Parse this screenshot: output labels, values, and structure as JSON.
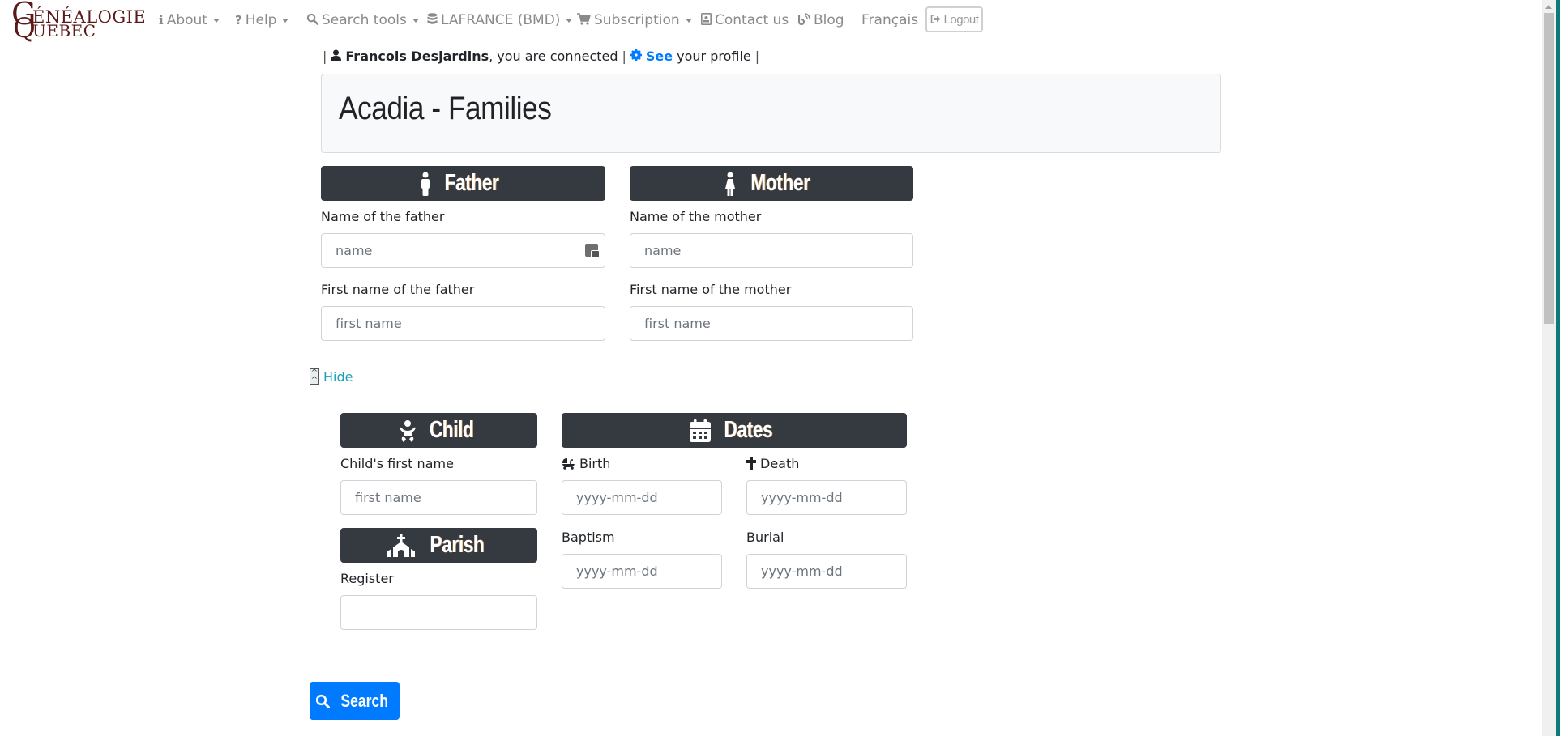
{
  "site": {
    "logo_line1": "ÉNÉALOGIE",
    "logo_line2": "UEBEC",
    "logo_g": "G",
    "logo_q": "Q"
  },
  "nav": {
    "items": [
      {
        "label": "About",
        "icon": "info-icon",
        "dropdown": true
      },
      {
        "label": "Help",
        "icon": "question-icon",
        "dropdown": true
      },
      {
        "label": "Search tools",
        "icon": "search-icon",
        "dropdown": true
      },
      {
        "label": "LAFRANCE (BMD)",
        "icon": "database-icon",
        "dropdown": true
      },
      {
        "label": "Subscription",
        "icon": "cart-icon",
        "dropdown": true
      },
      {
        "label": "Contact us",
        "icon": "contact-card-icon",
        "dropdown": false
      },
      {
        "label": "Blog",
        "icon": "rss-icon",
        "dropdown": false
      },
      {
        "label": "Français",
        "icon": "",
        "dropdown": false
      }
    ],
    "logout_label": "Logout"
  },
  "user": {
    "separator": "|",
    "name": "Francois Desjardins",
    "connected_text": ", you are connected",
    "see_label": "See",
    "profile_text": "your profile"
  },
  "page": {
    "title": "Acadia - Families"
  },
  "father": {
    "header": "Father",
    "name_label": "Name of the father",
    "name_placeholder": "name",
    "firstname_label": "First name of the father",
    "firstname_placeholder": "first name"
  },
  "mother": {
    "header": "Mother",
    "name_label": "Name of the mother",
    "name_placeholder": "name",
    "firstname_label": "First name of the mother",
    "firstname_placeholder": "first name"
  },
  "toggle": {
    "hide_label": "Hide"
  },
  "child": {
    "header": "Child",
    "firstname_label": "Child's first name",
    "firstname_placeholder": "first name"
  },
  "dates": {
    "header": "Dates",
    "birth_label": "Birth",
    "death_label": "Death",
    "baptism_label": "Baptism",
    "burial_label": "Burial",
    "placeholder": "yyyy-mm-dd"
  },
  "parish": {
    "header": "Parish",
    "register_label": "Register",
    "register_value": ""
  },
  "actions": {
    "search_label": "Search"
  },
  "colors": {
    "header_bg": "#343a40",
    "primary": "#007bff",
    "info": "#17a2b8",
    "logo": "#5a1a1a"
  }
}
